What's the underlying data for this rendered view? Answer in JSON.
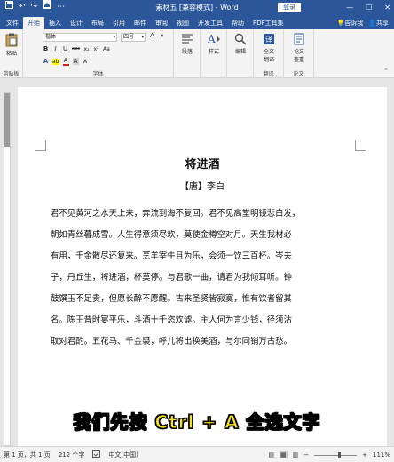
{
  "window": {
    "title": "素材五 [兼容模式] - Word",
    "login_label": "登录",
    "controls": [
      "—",
      "☐",
      "✕"
    ]
  },
  "quick_access": {
    "save_icon": "save-icon",
    "undo_icon": "undo-icon",
    "redo_icon": "redo-icon",
    "home_icon": "home-icon",
    "more": "⋯"
  },
  "tabs": [
    {
      "label": "文件"
    },
    {
      "label": "开始",
      "active": true
    },
    {
      "label": "插入"
    },
    {
      "label": "设计"
    },
    {
      "label": "布局"
    },
    {
      "label": "引用"
    },
    {
      "label": "邮件"
    },
    {
      "label": "审阅"
    },
    {
      "label": "视图"
    },
    {
      "label": "开发工具"
    },
    {
      "label": "帮助"
    },
    {
      "label": "PDF工具集"
    }
  ],
  "tab_right": {
    "tell_me": "告诉我",
    "share": "共享"
  },
  "ribbon": {
    "clipboard": {
      "paste_label": "粘贴",
      "group_label": "剪贴板"
    },
    "font": {
      "font_name": "楷体",
      "font_size": "四号",
      "row1": [
        "A",
        "A",
        "Aa",
        "A"
      ],
      "row2": [
        "B",
        "I",
        "U",
        "abc",
        "x₂",
        "x²"
      ],
      "row3": [
        "A",
        "ab",
        "A",
        "A"
      ],
      "group_label": "字体"
    },
    "paragraph": {
      "label": "段落"
    },
    "styles": {
      "label": "样式"
    },
    "editing": {
      "label": "编辑"
    },
    "translate": {
      "label1": "全文",
      "label2": "翻译",
      "group_label": "翻译"
    },
    "paper": {
      "label1": "论文",
      "label2": "查重",
      "group_label": "论文"
    }
  },
  "document": {
    "title": "将进酒",
    "author": "【唐】李白",
    "lines": [
      "君不见黄河之水天上来，奔流到海不复回。君不见高堂明镜悲白发，",
      "朝如青丝暮成雪。人生得意须尽欢，莫使金樽空对月。天生我材必",
      "有用，千金散尽还复来。烹羊宰牛且为乐，会须一饮三百杯。岑夫",
      "子，丹丘生，将进酒，杯莫停。与君歌一曲，请君为我倾耳听。钟",
      "鼓馔玉不足贵，但愿长醉不愿醒。古来圣贤皆寂寞，惟有饮者留其",
      "名。陈王昔时宴平乐，斗酒十千恣欢谑。主人何为言少钱，径须沽",
      "取对君酌。五花马、千金裘，呼儿将出换美酒，与尔同销万古愁。"
    ]
  },
  "caption": {
    "prefix": "我们先按 ",
    "keys": "Ctrl + A",
    "suffix": " 全选文字"
  },
  "status": {
    "page": "第 1 页，共 1 页",
    "words": "212 个字",
    "language": "中文(中国)",
    "zoom_minus": "−",
    "zoom_plus": "+",
    "zoom": "111%",
    "zoom_fraction": 0.55
  },
  "colors": {
    "accent": "#2b579a",
    "caption_highlight": "#f7e21a",
    "font_color_red": "#d21f1f"
  }
}
